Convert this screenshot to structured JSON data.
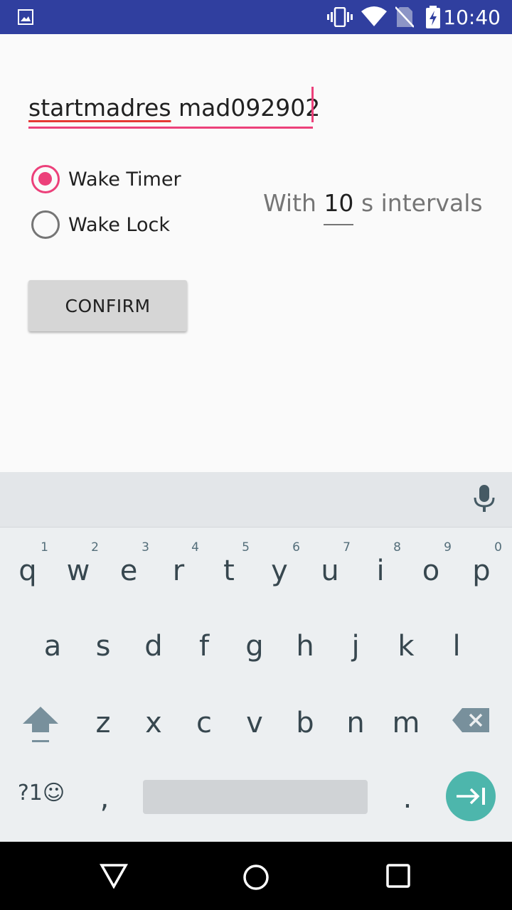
{
  "status_bar": {
    "time": "10:40",
    "icons": [
      "image-icon",
      "vibrate-icon",
      "wifi-icon",
      "no-sim-icon",
      "battery-charging-icon"
    ],
    "color": "#303f9f"
  },
  "form": {
    "text_field": {
      "value_word1": "startmadres",
      "value_rest": " mad092902"
    },
    "radio_options": [
      {
        "label": "Wake Timer",
        "checked": true
      },
      {
        "label": "Wake Lock",
        "checked": false
      }
    ],
    "interval": {
      "prefix": "With",
      "value": "10",
      "suffix": "s intervals"
    },
    "confirm_label": "CONFIRM",
    "accent": "#ec407a"
  },
  "keyboard": {
    "row1": [
      {
        "k": "q",
        "h": "1"
      },
      {
        "k": "w",
        "h": "2"
      },
      {
        "k": "e",
        "h": "3"
      },
      {
        "k": "r",
        "h": "4"
      },
      {
        "k": "t",
        "h": "5"
      },
      {
        "k": "y",
        "h": "6"
      },
      {
        "k": "u",
        "h": "7"
      },
      {
        "k": "i",
        "h": "8"
      },
      {
        "k": "o",
        "h": "9"
      },
      {
        "k": "p",
        "h": "0"
      }
    ],
    "row2": [
      "a",
      "s",
      "d",
      "f",
      "g",
      "h",
      "j",
      "k",
      "l"
    ],
    "row3": [
      "z",
      "x",
      "c",
      "v",
      "b",
      "n",
      "m"
    ],
    "symbols_label": "?1☺",
    "comma": ",",
    "period": ".",
    "enter_color": "#4db6ac"
  },
  "nav_bar": {
    "buttons": [
      "back-icon",
      "home-icon",
      "recents-icon"
    ]
  }
}
